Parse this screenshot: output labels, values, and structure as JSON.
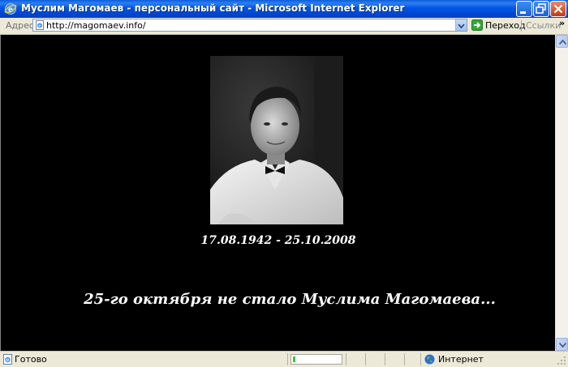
{
  "window": {
    "title": "Муслим Магомаев - персональный сайт - Microsoft Internet Explorer"
  },
  "address_bar": {
    "label": "Адрес:",
    "url": "http://magomaev.info/",
    "go_label": "Переход",
    "links_label": "Ссылки",
    "chevron": "»"
  },
  "page": {
    "background": "#000000",
    "text_color": "#ffffff",
    "portrait_icon": "portrait-photo",
    "dates": "17.08.1942 - 25.10.2008",
    "memorial_text": "25-го октября не стало Муслима Магомаева..."
  },
  "status_bar": {
    "status_text": "Готово",
    "progress_percent": 5,
    "zone_text": "Интернет"
  },
  "colors": {
    "titlebar": "#0055e5",
    "chrome": "#ece9d8",
    "progress": "#37c83a"
  }
}
